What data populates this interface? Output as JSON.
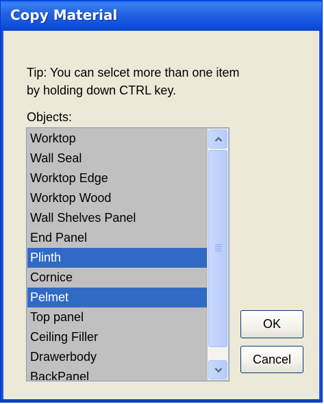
{
  "window": {
    "title": "Copy Material"
  },
  "tip": {
    "line1": "Tip: You can selcet more than one item",
    "line2": "by holding down CTRL key."
  },
  "objects": {
    "label": "Objects:",
    "items": [
      {
        "label": "Worktop",
        "selected": false
      },
      {
        "label": "Wall Seal",
        "selected": false
      },
      {
        "label": "Worktop Edge",
        "selected": false
      },
      {
        "label": "Worktop Wood",
        "selected": false
      },
      {
        "label": "Wall Shelves Panel",
        "selected": false
      },
      {
        "label": "End Panel",
        "selected": false
      },
      {
        "label": "Plinth",
        "selected": true
      },
      {
        "label": "Cornice",
        "selected": false
      },
      {
        "label": "Pelmet",
        "selected": true
      },
      {
        "label": "Top panel",
        "selected": false
      },
      {
        "label": "Ceiling Filler",
        "selected": false
      },
      {
        "label": "Drawerbody",
        "selected": false
      },
      {
        "label": "BackPanel",
        "selected": false
      }
    ]
  },
  "buttons": {
    "ok_label": "OK",
    "cancel_label": "Cancel"
  },
  "colors": {
    "selection": "#316ac5",
    "list_background": "#c0c0c0",
    "titlebar": "#0c4fd9"
  }
}
